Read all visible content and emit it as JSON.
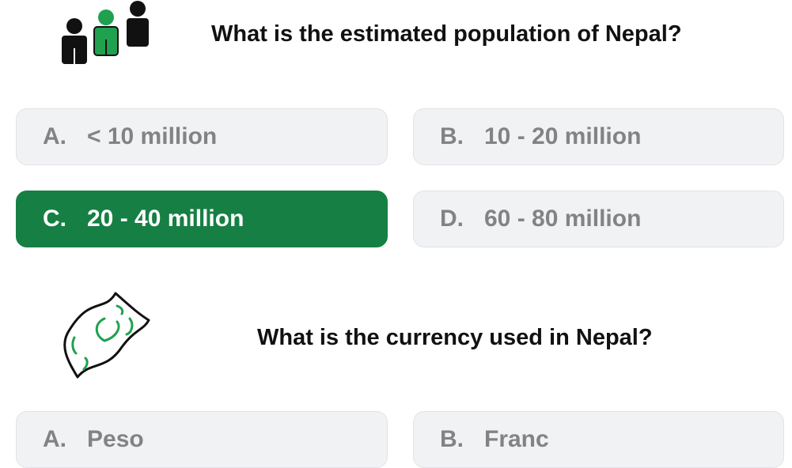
{
  "questions": [
    {
      "icon": "people-icon",
      "text": "What is the estimated population of Nepal?",
      "options": [
        {
          "letter": "A.",
          "label": "< 10 million",
          "selected": false
        },
        {
          "letter": "B.",
          "label": "10 - 20 million",
          "selected": false
        },
        {
          "letter": "C.",
          "label": "20 - 40 million",
          "selected": true
        },
        {
          "letter": "D.",
          "label": "60 - 80 million",
          "selected": false
        }
      ]
    },
    {
      "icon": "banknote-icon",
      "text": "What is the currency used in Nepal?",
      "options": [
        {
          "letter": "A.",
          "label": "Peso",
          "selected": false
        },
        {
          "letter": "B.",
          "label": "Franc",
          "selected": false
        }
      ]
    }
  ],
  "colors": {
    "selected": "#167f44",
    "option_bg": "#f1f2f4",
    "option_text": "#838383",
    "icon_green": "#1fa14f"
  }
}
